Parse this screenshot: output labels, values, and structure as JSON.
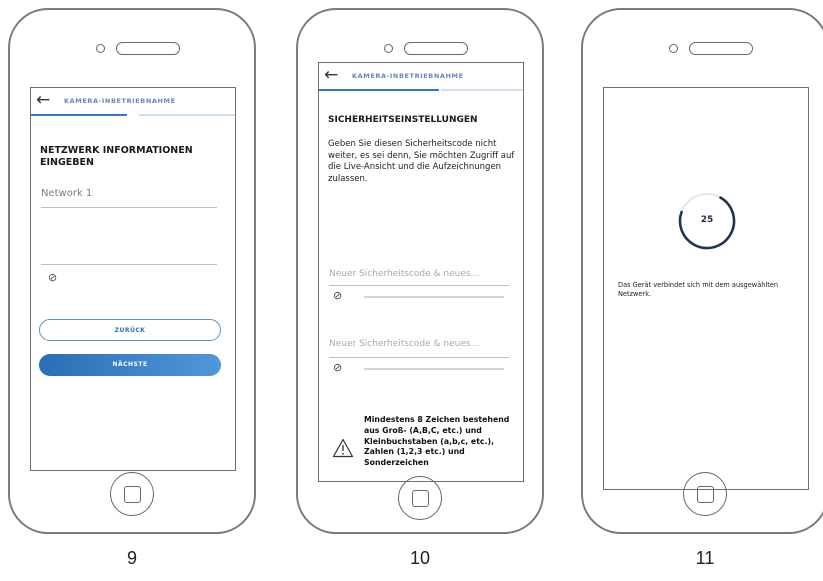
{
  "phones": [
    {
      "step": "9",
      "nav_title": "KAMERA-INBETRIEBNAHME",
      "heading": "NETZWERK INFORMATIONEN EINGEBEN",
      "network_value": "Network 1",
      "back_button": "ZURÜCK",
      "next_button": "NÄCHSTE"
    },
    {
      "step": "10",
      "nav_title": "KAMERA-INBETRIEBNAHME",
      "heading": "SICHERHEITSEINSTELLUNGEN",
      "paragraph": "Geben Sie diesen Sicherheitscode nicht weiter, es sei denn, Sie möchten Zugriff auf die Live-Ansicht und die Aufzeichnungen zulassen.",
      "placeholder_1": "Neuer Sicherheitscode & neues...",
      "placeholder_2": "Neuer Sicherheitscode & neues...",
      "warning": "Mindestens 8 Zeichen bestehend aus Groß- (A,B,C, etc.) und Kleinbuchstaben (a,b,c, etc.), Zahlen (1,2,3 etc.) und Sonderzeichen"
    },
    {
      "step": "11",
      "countdown": "25",
      "countdown_progress": 0.72,
      "status": "Das Gerät verbindet sich mit dem ausgewählten Netzwerk."
    }
  ],
  "icons": {
    "back": "arrow-left-icon",
    "eye": "eye-hidden-icon",
    "warning": "warning-triangle-icon",
    "home": "home-button-icon"
  },
  "colors": {
    "accent": "#2f7bc3",
    "nav_title": "#6a87b9",
    "button_gradient_start": "#2b6db6",
    "button_gradient_end": "#4f98d9"
  }
}
